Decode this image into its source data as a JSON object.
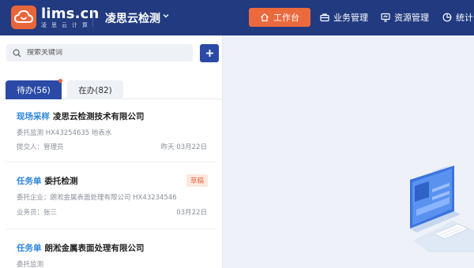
{
  "header": {
    "logo_main": "lims.cn",
    "logo_sub": "凌思云计算",
    "company": "凌思云检测",
    "nav": [
      {
        "label": "工作台",
        "icon": "home-icon"
      },
      {
        "label": "业务管理",
        "icon": "briefcase-icon"
      },
      {
        "label": "资源管理",
        "icon": "monitor-icon"
      },
      {
        "label": "统计",
        "icon": "pie-chart-icon"
      }
    ]
  },
  "search": {
    "placeholder": "搜索关键词"
  },
  "tabs": [
    {
      "label": "待办(56)",
      "active": true
    },
    {
      "label": "在办(82)",
      "active": false
    }
  ],
  "cards": [
    {
      "tag": "现场采样",
      "title": "凌思云检测技术有限公司",
      "line1": "委托监测   HX43254635   地表水",
      "line2": "提交人：管理员",
      "date": "昨天  03月22日"
    },
    {
      "tag": "任务单",
      "title": "委托检测",
      "badge": "草稿",
      "line1": "委托企业：朗淞金属表面处理有限公司   HX43234546",
      "line2": "业务员：张三",
      "date": "03月22日"
    },
    {
      "tag": "任务单",
      "title": "朗淞金属表面处理有限公司",
      "line1": "委托监测"
    }
  ],
  "colors": {
    "header_bg": "#213a80",
    "accent_orange": "#ea6a3e",
    "primary_blue": "#2b4aa6",
    "tag_blue": "#2e86de"
  }
}
